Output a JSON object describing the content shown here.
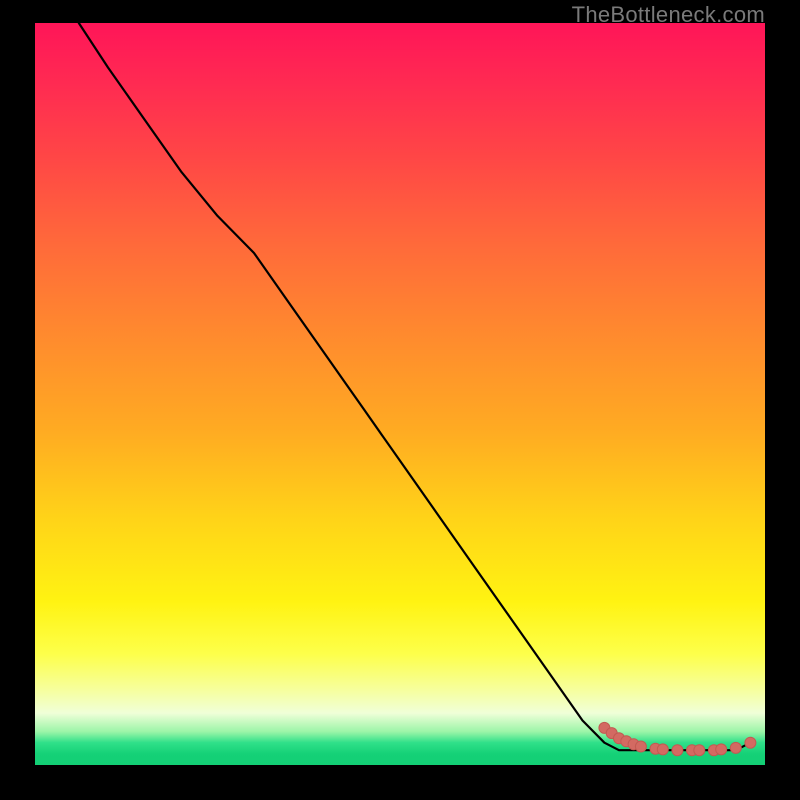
{
  "watermark": "TheBottleneck.com",
  "colors": {
    "curve_stroke": "#000000",
    "marker_fill": "#d36a62",
    "marker_stroke": "#c25a52"
  },
  "chart_data": {
    "type": "line",
    "title": "",
    "xlabel": "",
    "ylabel": "",
    "xlim": [
      0,
      100
    ],
    "ylim": [
      0,
      100
    ],
    "note": "No axis ticks or labels rendered; values estimated from pixel positions.",
    "x": [
      6,
      10,
      15,
      20,
      25,
      30,
      35,
      40,
      45,
      50,
      55,
      60,
      65,
      70,
      75,
      78,
      80,
      82,
      84,
      86,
      88,
      90,
      92,
      94,
      96,
      98
    ],
    "y": [
      100,
      94,
      87,
      80,
      74,
      69,
      62,
      55,
      48,
      41,
      34,
      27,
      20,
      13,
      6,
      3,
      2,
      2,
      2,
      2,
      2,
      2,
      2,
      2,
      2,
      3
    ],
    "markers_x": [
      78,
      79,
      80,
      81,
      82,
      83,
      85,
      86,
      88,
      90,
      91,
      93,
      94,
      96,
      98
    ],
    "markers_y": [
      5,
      4.3,
      3.6,
      3.2,
      2.8,
      2.5,
      2.2,
      2.1,
      2.0,
      2.0,
      2.0,
      2.0,
      2.1,
      2.3,
      3.0
    ]
  }
}
